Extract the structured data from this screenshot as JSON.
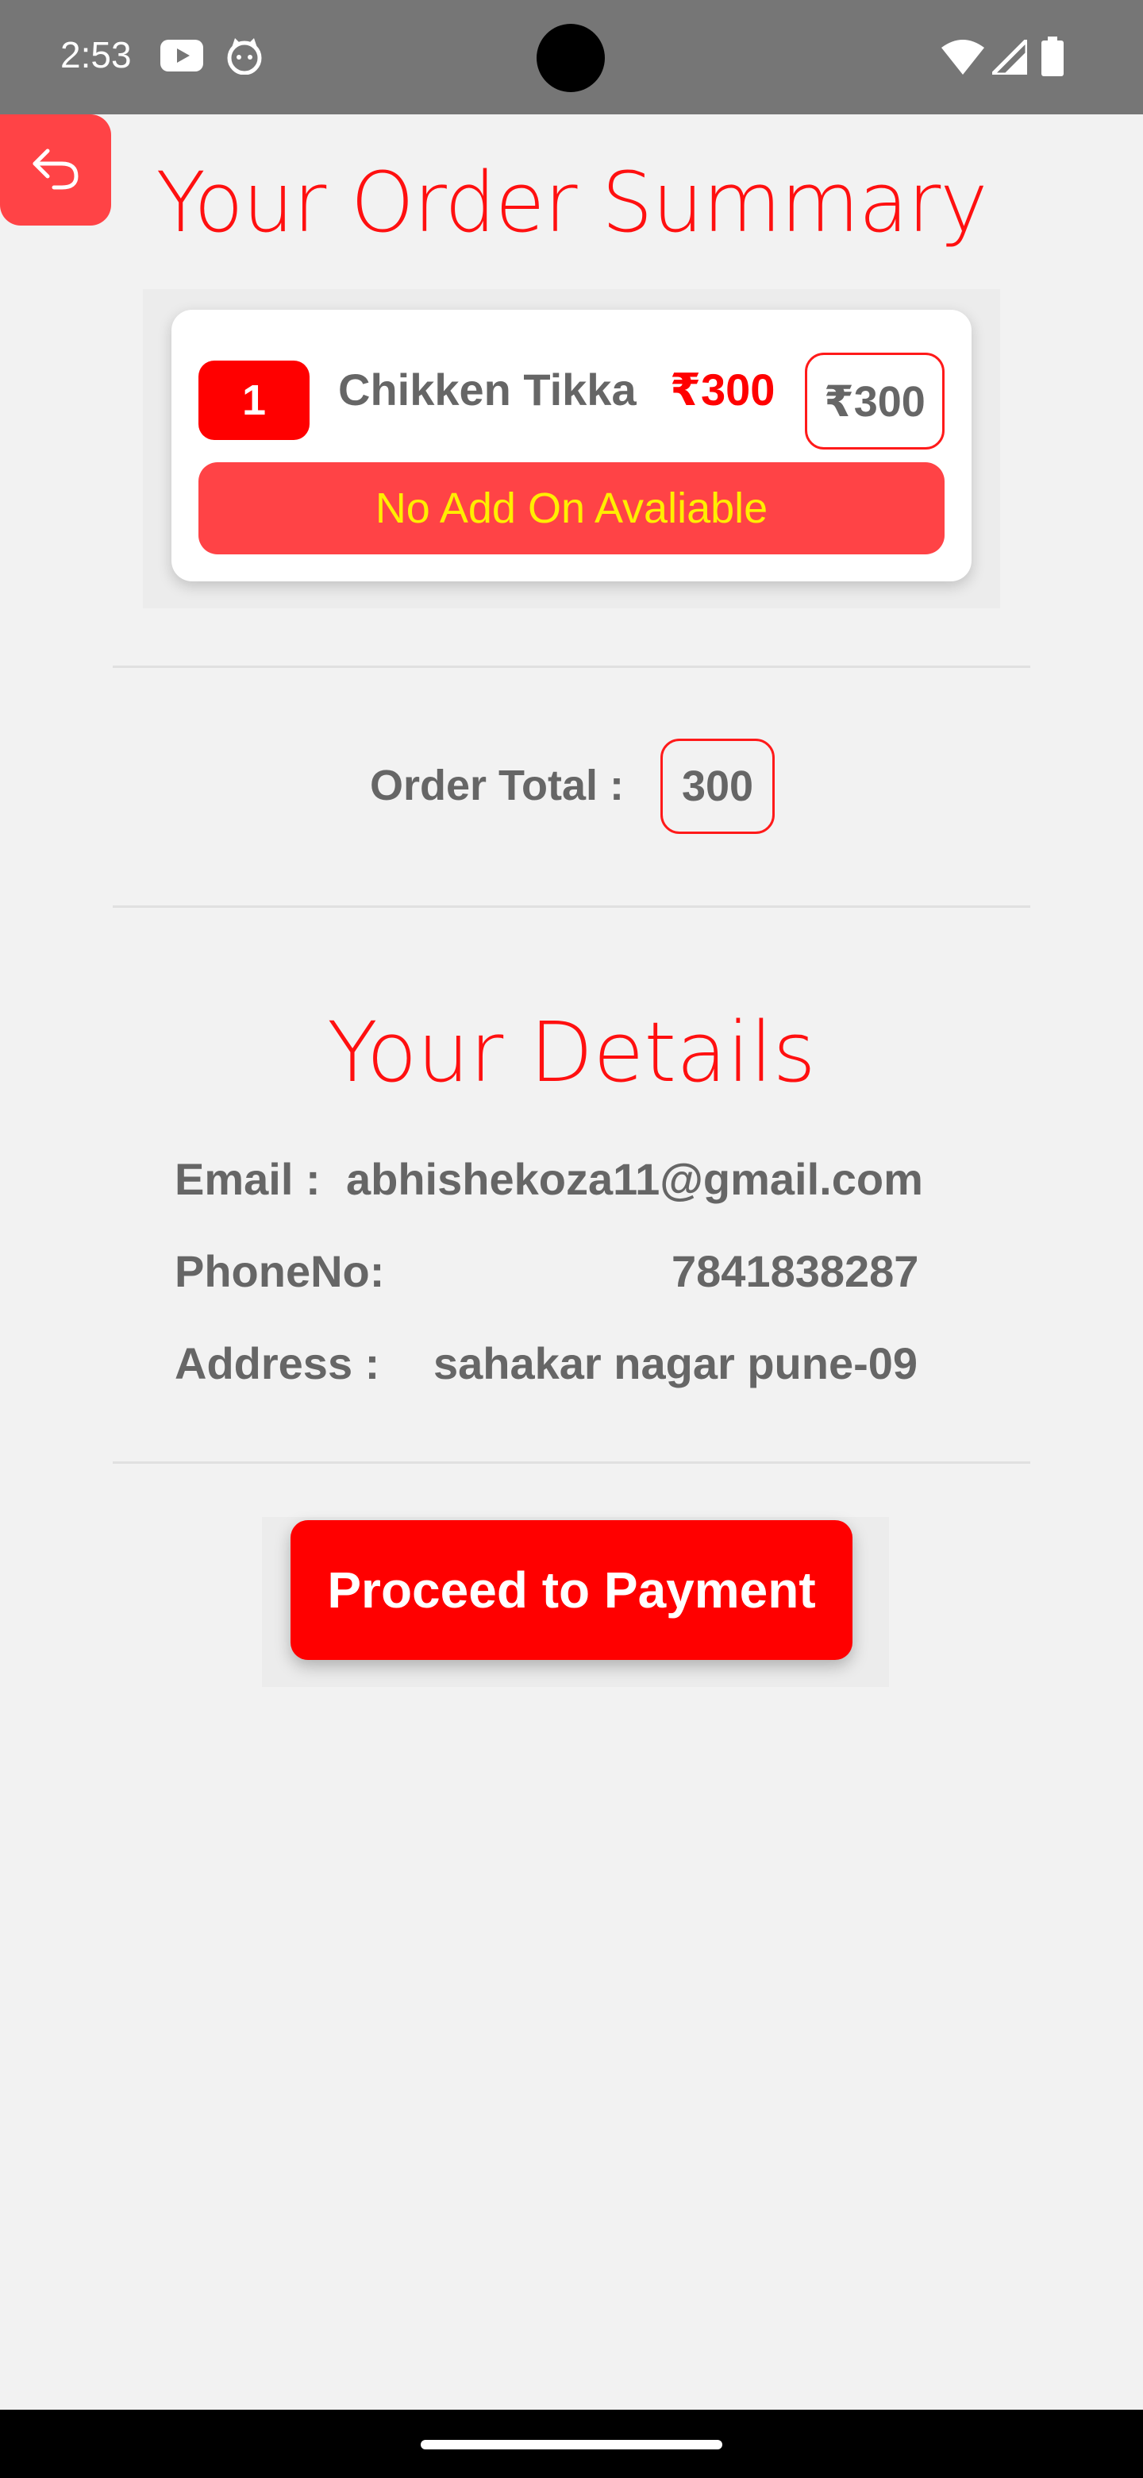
{
  "status_bar": {
    "time": "2:53",
    "icons": [
      "youtube-icon",
      "cat-icon",
      "wifi-icon",
      "signal-icon",
      "battery-icon"
    ]
  },
  "header": {
    "back_icon": "undo-arrow-icon",
    "title": "Your Order Summary"
  },
  "cart": {
    "items": [
      {
        "quantity": "1",
        "name": "Chikken Tikka",
        "price": "₹300",
        "total": "₹300",
        "addon_text": "No Add On Avaliable"
      }
    ]
  },
  "order_total": {
    "label": "Order Total :",
    "value": "300"
  },
  "details": {
    "title": "Your Details",
    "email_label": "Email :",
    "email_value": "abhishekoza11@gmail.com",
    "phone_label": "PhoneNo:",
    "phone_value": "7841838287",
    "address_label": "Address :",
    "address_value": "sahakar nagar pune-09"
  },
  "actions": {
    "proceed_label": "Proceed to Payment"
  },
  "colors": {
    "accent": "#ff0000",
    "accent_soft": "#ff4346",
    "addon_text": "#ffee00",
    "text_gray": "#666666",
    "background": "#f2f2f2"
  }
}
